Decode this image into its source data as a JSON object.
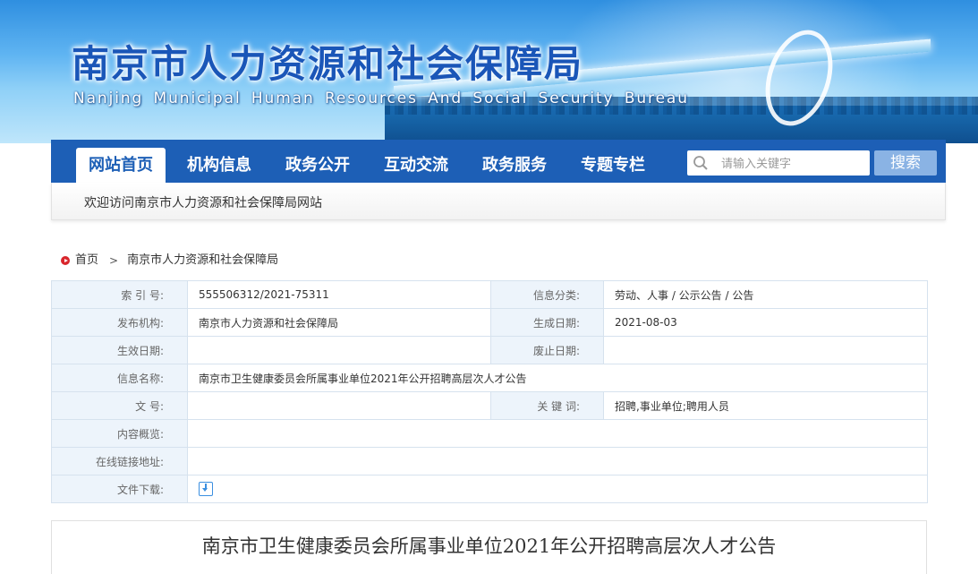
{
  "header": {
    "title": "南京市人力资源和社会保障局",
    "subtitle": "Nanjing Municipal Human Resources And Social Security Bureau"
  },
  "nav": {
    "items": [
      {
        "label": "网站首页",
        "active": true
      },
      {
        "label": "机构信息",
        "active": false
      },
      {
        "label": "政务公开",
        "active": false
      },
      {
        "label": "互动交流",
        "active": false
      },
      {
        "label": "政务服务",
        "active": false
      },
      {
        "label": "专题专栏",
        "active": false
      }
    ],
    "search_placeholder": "请输入关键字",
    "search_button": "搜索"
  },
  "welcome": "欢迎访问南京市人力资源和社会保障局网站",
  "breadcrumb": {
    "home": "首页",
    "separator": ">",
    "current": "南京市人力资源和社会保障局"
  },
  "meta": {
    "index_label": "索 引 号:",
    "index_value": "555506312/2021-75311",
    "category_label": "信息分类:",
    "category_value": "劳动、人事 / 公示公告 / 公告",
    "publisher_label": "发布机构:",
    "publisher_value": "南京市人力资源和社会保障局",
    "created_label": "生成日期:",
    "created_value": "2021-08-03",
    "effective_label": "生效日期:",
    "effective_value": "",
    "expiry_label": "废止日期:",
    "expiry_value": "",
    "name_label": "信息名称:",
    "name_value": "南京市卫生健康委员会所属事业单位2021年公开招聘高层次人才公告",
    "docno_label": "文 号:",
    "docno_value": "",
    "keywords_label": "关 键 词:",
    "keywords_value": "招聘,事业单位;聘用人员",
    "summary_label": "内容概览:",
    "summary_value": "",
    "link_label": "在线链接地址:",
    "link_value": "",
    "download_label": "文件下载:"
  },
  "article": {
    "title": "南京市卫生健康委员会所属事业单位2021年公开招聘高层次人才公告"
  },
  "colors": {
    "nav_blue": "#1d5fb6",
    "label_bg": "#edf4fb",
    "border": "#d6e2ee",
    "search_button": "#8ab3e4"
  }
}
